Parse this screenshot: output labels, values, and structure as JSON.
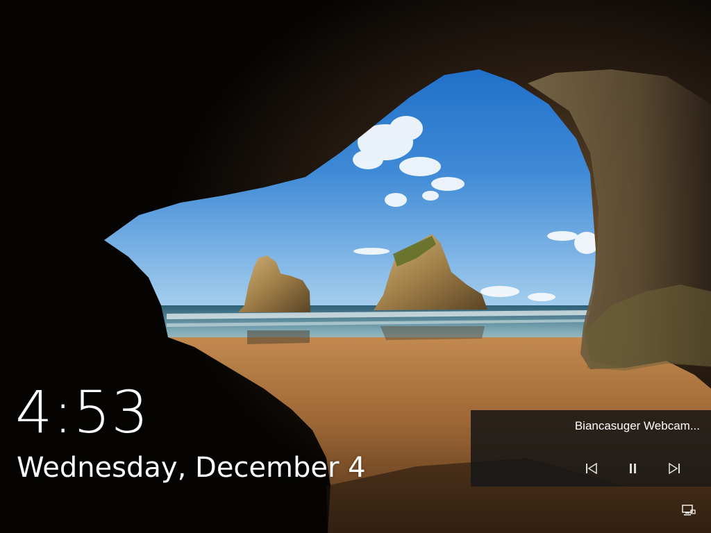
{
  "lock_screen": {
    "time": "4:53",
    "date": "Wednesday, December 4"
  },
  "media_controls": {
    "title": "Biancasuger Webcam...",
    "previous_icon": "previous-track-icon",
    "pause_icon": "pause-icon",
    "next_icon": "next-track-icon"
  },
  "system_tray": {
    "network_icon": "network-icon"
  },
  "colors": {
    "text": "#ffffff",
    "panel_background": "#161616",
    "sky": "#2f79c8",
    "sand": "#9c6a36"
  }
}
